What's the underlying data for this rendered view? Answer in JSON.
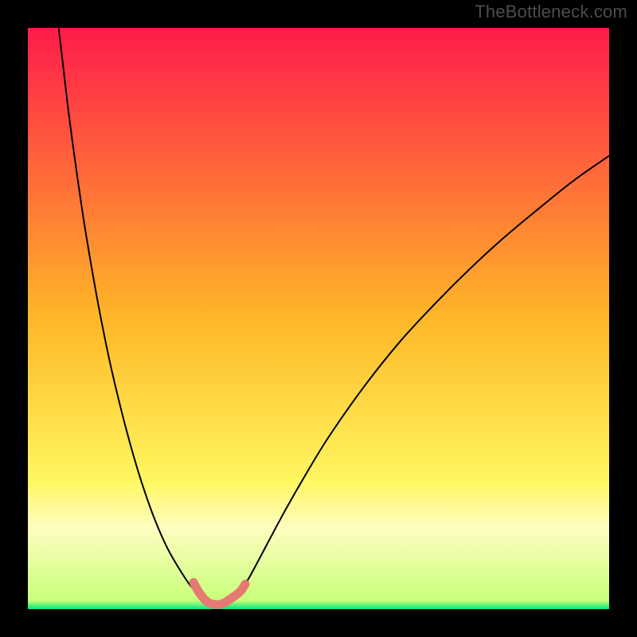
{
  "watermark": "TheBottleneck.com",
  "chart_data": {
    "type": "line",
    "title": "",
    "xlabel": "",
    "ylabel": "",
    "xlim": [
      0,
      100
    ],
    "ylim": [
      0,
      100
    ],
    "grid": false,
    "legend": false,
    "annotations": [],
    "background_gradient": [
      {
        "stop": 0.0,
        "color": "#ff1b4b"
      },
      {
        "stop": 0.5,
        "color": "#ffb728"
      },
      {
        "stop": 0.78,
        "color": "#fff760"
      },
      {
        "stop": 0.86,
        "color": "#fffdc1"
      },
      {
        "stop": 0.985,
        "color": "#c9ff7a"
      },
      {
        "stop": 1.0,
        "color": "#00e87e"
      }
    ],
    "series": [
      {
        "name": "curve-left",
        "type": "line",
        "color": "#000000",
        "width": 2,
        "x": [
          5.3,
          6,
          7,
          8,
          9,
          10,
          12,
          14,
          16,
          18,
          20,
          22,
          24,
          26,
          28,
          29.5
        ],
        "y": [
          100,
          94,
          85.5,
          78,
          71,
          64.5,
          53,
          43,
          34.5,
          27,
          20.5,
          15,
          10.5,
          7,
          4,
          2.6
        ]
      },
      {
        "name": "curve-right",
        "type": "line",
        "color": "#000000",
        "width": 2,
        "x": [
          36.5,
          38,
          40,
          44,
          48,
          52,
          58,
          64,
          70,
          76,
          82,
          88,
          94,
          100
        ],
        "y": [
          3,
          5.3,
          9,
          16.5,
          23.5,
          30,
          38.5,
          46,
          52.5,
          58.5,
          64,
          69,
          73.8,
          78
        ]
      },
      {
        "name": "salmon-segment",
        "type": "line",
        "color": "#e47a72",
        "width": 11,
        "linecap": "round",
        "x": [
          28.5,
          29.5,
          30.8,
          32.2,
          33.6,
          35.2,
          36.5,
          37.4
        ],
        "y": [
          4.6,
          2.8,
          1.3,
          0.8,
          1.0,
          2.0,
          3.0,
          4.3
        ]
      }
    ]
  }
}
